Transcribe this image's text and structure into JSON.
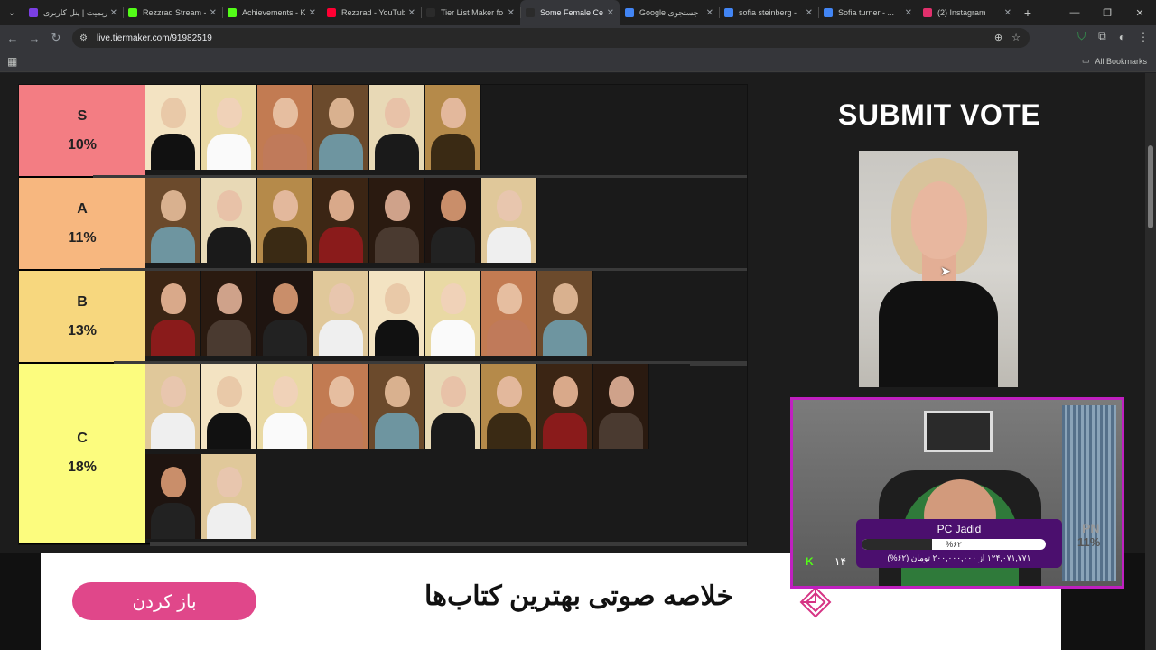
{
  "tabs": [
    {
      "title": "ریمیت | پنل کاربری",
      "color": "#7b3fe4",
      "active": false
    },
    {
      "title": "Rezzrad Stream -",
      "color": "#53fc18",
      "active": false
    },
    {
      "title": "Achievements - K",
      "color": "#53fc18",
      "active": false
    },
    {
      "title": "Rezzrad - YouTub",
      "color": "#ff0033",
      "active": false
    },
    {
      "title": "Tier List Maker fo",
      "color": "#2b2b2b",
      "active": false
    },
    {
      "title": "Some Female Cel",
      "color": "#2b2b2b",
      "active": true
    },
    {
      "title": "Google جستجوی",
      "color": "#4285f4",
      "active": false
    },
    {
      "title": "sofia steinberg -",
      "color": "#4285f4",
      "active": false
    },
    {
      "title": "Sofia turner - ...",
      "color": "#4285f4",
      "active": false
    },
    {
      "title": "(2) Instagram",
      "color": "#e1306c",
      "active": false
    }
  ],
  "toolbar": {
    "url": "live.tiermaker.com/91982519"
  },
  "bookmarks": {
    "all_bookmarks": "All Bookmarks"
  },
  "tiers": [
    {
      "letter": "S",
      "percent": "10%",
      "color": "#f37d83",
      "rows": 1,
      "items": 6,
      "scroll_left_fraction": 0.0
    },
    {
      "letter": "A",
      "percent": "11%",
      "color": "#f7b77f",
      "rows": 1,
      "items": 7,
      "scroll_left_fraction": 0.0
    },
    {
      "letter": "B",
      "percent": "13%",
      "color": "#f7d77e",
      "rows": 1,
      "items": 8,
      "scroll_left_fraction": 0.0
    },
    {
      "letter": "C",
      "percent": "18%",
      "color": "#fcfc7e",
      "rows": 2,
      "items": 11,
      "scroll_left_fraction": 0.0
    }
  ],
  "submit": {
    "title": "SUBMIT VOTE"
  },
  "webcam": {
    "k_badge": "K",
    "k_count": "۱۴"
  },
  "ad": {
    "button": "باز کردن",
    "text": "خلاصه صوتی بهترین کتاب‌ها"
  },
  "donation": {
    "title": "PC Jadid",
    "percent_label": "%۶۲",
    "progress": 0.38,
    "subtitle": "۱۲۴,۰۷۱,۷۷۱ از ۲۰۰,۰۰۰,۰۰۰ تومان (۶۲%)"
  },
  "overlay": {
    "pn": "PN",
    "pn_sub": "11%"
  },
  "colors": {
    "accent_pink": "#e0478a",
    "webcam_border": "#c020c0"
  }
}
